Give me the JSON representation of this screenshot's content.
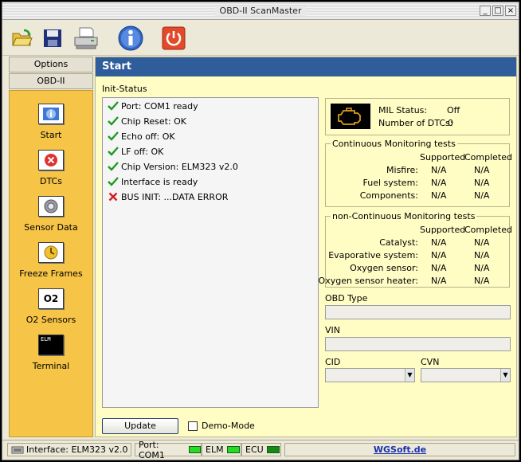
{
  "window": {
    "title": "OBD-II ScanMaster"
  },
  "toolbar": {
    "buttons": [
      {
        "icon": "folder-open-icon",
        "color": "#e6c440"
      },
      {
        "icon": "save-icon",
        "color": "#20307a"
      },
      {
        "icon": "printer-icon",
        "color": "#9a9a9a"
      },
      {
        "icon": "info-icon",
        "color": "#2f66c7"
      },
      {
        "icon": "power-icon",
        "color": "#e24a2a"
      }
    ]
  },
  "sidebar": {
    "tabs": [
      "Options",
      "OBD-II"
    ],
    "items": [
      {
        "label": "Start",
        "icon": "start-icon"
      },
      {
        "label": "DTCs",
        "icon": "dtc-icon"
      },
      {
        "label": "Sensor Data",
        "icon": "sensor-data-icon"
      },
      {
        "label": "Freeze Frames",
        "icon": "freeze-frames-icon"
      },
      {
        "label": "O2 Sensors",
        "icon": "o2-sensor-icon",
        "icon_text": "O2"
      },
      {
        "label": "Terminal",
        "icon": "terminal-icon",
        "icon_text": "ELM"
      }
    ]
  },
  "main": {
    "title": "Start",
    "init_status_label": "Init-Status",
    "init_lines": [
      {
        "text": "Port: COM1 ready",
        "status": "ok"
      },
      {
        "text": "Chip Reset: OK",
        "status": "ok"
      },
      {
        "text": "Echo off: OK",
        "status": "ok"
      },
      {
        "text": "LF off: OK",
        "status": "ok"
      },
      {
        "text": "Chip Version: ELM323 v2.0",
        "status": "ok"
      },
      {
        "text": "Interface is ready",
        "status": "ok"
      },
      {
        "text": "BUS INIT: ...DATA ERROR",
        "status": "error"
      }
    ],
    "mil": {
      "status_label": "MIL Status:",
      "status_value": "Off",
      "dtc_label": "Number of DTCs:",
      "dtc_value": "0"
    },
    "continuous": {
      "legend": "Continuous Monitoring tests",
      "col_supported": "Supported",
      "col_completed": "Completed",
      "rows": [
        {
          "name": "Misfire:",
          "supported": "N/A",
          "completed": "N/A"
        },
        {
          "name": "Fuel system:",
          "supported": "N/A",
          "completed": "N/A"
        },
        {
          "name": "Components:",
          "supported": "N/A",
          "completed": "N/A"
        }
      ]
    },
    "non_continuous": {
      "legend": "non-Continuous Monitoring tests",
      "col_supported": "Supported",
      "col_completed": "Completed",
      "rows": [
        {
          "name": "Catalyst:",
          "supported": "N/A",
          "completed": "N/A"
        },
        {
          "name": "Evaporative system:",
          "supported": "N/A",
          "completed": "N/A"
        },
        {
          "name": "Oxygen sensor:",
          "supported": "N/A",
          "completed": "N/A"
        },
        {
          "name": "Oxygen sensor heater:",
          "supported": "N/A",
          "completed": "N/A"
        }
      ]
    },
    "obd_type_label": "OBD Type",
    "obd_type_value": "",
    "vin_label": "VIN",
    "vin_value": "",
    "cid_label": "CID",
    "cid_value": "",
    "cvn_label": "CVN",
    "cvn_value": "",
    "update_button": "Update",
    "demo_mode_label": "Demo-Mode",
    "demo_mode_checked": false
  },
  "statusbar": {
    "interface": "Interface: ELM323 v2.0",
    "port": "Port: COM1",
    "elm": "ELM",
    "ecu": "ECU",
    "brand": "WGSoft.de",
    "port_led_color": "#22dd22",
    "elm_led_color": "#22dd22",
    "ecu_led_color": "#158a15",
    "brand_color": "#1a2fb0"
  },
  "colors": {
    "header_blue": "#2f5c9a",
    "panel_yellow": "#fffcc4",
    "sidebar_orange": "#f6c447"
  }
}
